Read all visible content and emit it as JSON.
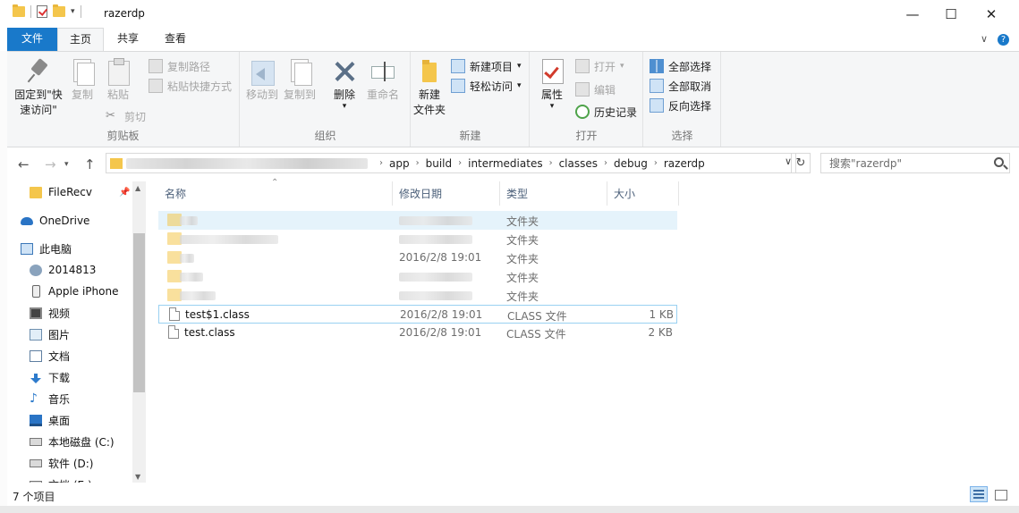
{
  "window": {
    "title": "razerdp",
    "minimize_glyph": "—",
    "maximize_glyph": "☐",
    "close_glyph": "✕",
    "qat_dropdown_glyph": "▾"
  },
  "tabs": {
    "file": "文件",
    "home": "主页",
    "share": "共享",
    "view": "查看",
    "expand_glyph": "∨",
    "help_glyph": "?"
  },
  "ribbon": {
    "clipboard": {
      "label": "剪贴板",
      "pin_line1": "固定到\"快",
      "pin_line2": "速访问\"",
      "copy": "复制",
      "paste": "粘贴",
      "copy_path": "复制路径",
      "paste_shortcut": "粘贴快捷方式",
      "cut": "剪切"
    },
    "organize": {
      "label": "组织",
      "move_to": "移动到",
      "copy_to": "复制到",
      "delete": "删除",
      "rename": "重命名"
    },
    "new": {
      "label": "新建",
      "new_folder_line1": "新建",
      "new_folder_line2": "文件夹",
      "new_item": "新建项目",
      "easy_access": "轻松访问"
    },
    "open": {
      "label": "打开",
      "properties": "属性",
      "open": "打开",
      "edit": "编辑",
      "history": "历史记录"
    },
    "select": {
      "label": "选择",
      "select_all": "全部选择",
      "select_none": "全部取消",
      "invert": "反向选择"
    },
    "dropdown_glyph": "▾"
  },
  "address": {
    "crumbs": [
      "app",
      "build",
      "intermediates",
      "classes",
      "debug",
      "razerdp"
    ],
    "search_placeholder": "搜索\"razerdp\"",
    "back_glyph": "←",
    "forward_glyph": "→",
    "up_glyph": "↑",
    "crumb_sep_glyph": "›",
    "dropdown_glyph": "∨",
    "refresh_glyph": "↻"
  },
  "nav": {
    "pin_glyph": "📌",
    "scroll_up_glyph": "▲",
    "scroll_down_glyph": "▼",
    "items": [
      {
        "label": "FileRecv",
        "icon": "folder-icon"
      },
      {
        "label": "OneDrive",
        "icon": "cloud-icon"
      },
      {
        "label": "此电脑",
        "icon": "computer-icon"
      },
      {
        "label": "2014813",
        "icon": "user-icon"
      },
      {
        "label": "Apple iPhone",
        "icon": "phone-icon"
      },
      {
        "label": "视频",
        "icon": "video-icon"
      },
      {
        "label": "图片",
        "icon": "picture-icon"
      },
      {
        "label": "文档",
        "icon": "document-icon"
      },
      {
        "label": "下载",
        "icon": "download-icon"
      },
      {
        "label": "音乐",
        "icon": "music-icon"
      },
      {
        "label": "桌面",
        "icon": "desktop-icon"
      },
      {
        "label": "本地磁盘 (C:)",
        "icon": "drive-icon"
      },
      {
        "label": "软件 (D:)",
        "icon": "drive-icon"
      },
      {
        "label": "文档 (E:)",
        "icon": "drive-icon"
      }
    ],
    "music_glyph": "♪"
  },
  "columns": {
    "name": "名称",
    "date": "修改日期",
    "type": "类型",
    "size": "大小",
    "sort_glyph": "⌃"
  },
  "files": [
    {
      "name": "",
      "date": "",
      "type": "文件夹",
      "size": ""
    },
    {
      "name": "",
      "date": "",
      "type": "文件夹",
      "size": ""
    },
    {
      "name": "",
      "date": "2016/2/8 19:01",
      "type": "文件夹",
      "size": ""
    },
    {
      "name": "",
      "date": "",
      "type": "文件夹",
      "size": ""
    },
    {
      "name": "",
      "date": "",
      "type": "文件夹",
      "size": ""
    },
    {
      "name": "test$1.class",
      "date": "2016/2/8 19:01",
      "type": "CLASS 文件",
      "size": "1 KB"
    },
    {
      "name": "test.class",
      "date": "2016/2/8 19:01",
      "type": "CLASS 文件",
      "size": "2 KB"
    }
  ],
  "status": {
    "count": "7 个项目"
  }
}
